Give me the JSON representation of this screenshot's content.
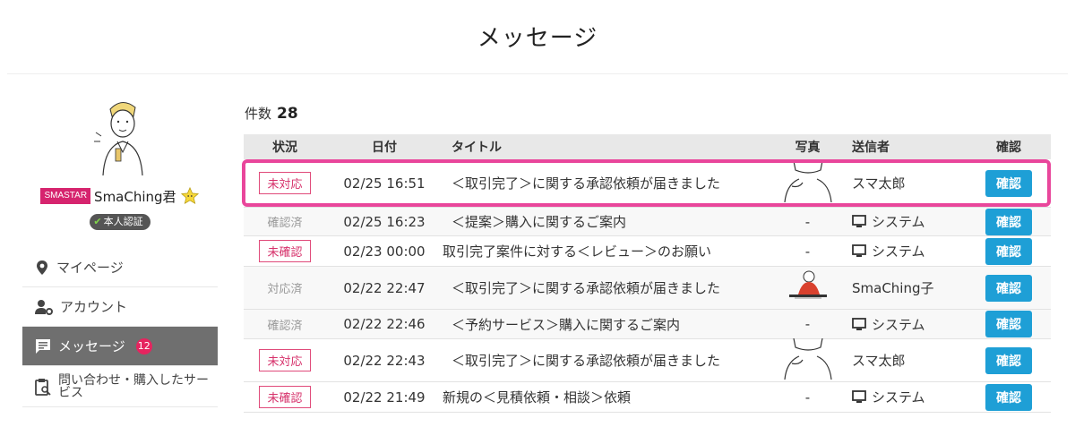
{
  "page": {
    "title": "メッセージ"
  },
  "sidebar": {
    "brand_badge": "SMASTAR",
    "user_name": "SmaChing君",
    "verify_label": "本人認証",
    "nav": [
      {
        "label": "マイページ",
        "icon": "map-pin-icon"
      },
      {
        "label": "アカウント",
        "icon": "user-gear-icon"
      },
      {
        "label": "メッセージ",
        "icon": "message-icon",
        "count": "12",
        "active": true
      },
      {
        "label": "問い合わせ・購入したサービス",
        "icon": "clipboard-search-icon"
      }
    ]
  },
  "summary": {
    "count_label": "件数",
    "count_value": "28"
  },
  "table": {
    "headers": {
      "status": "状況",
      "date": "日付",
      "title": "タイトル",
      "photo": "写真",
      "sender": "送信者",
      "confirm": "確認"
    },
    "rows": [
      {
        "status": "未対応",
        "status_type": "box",
        "date": "02/25 16:51",
        "title": "＜取引完了＞に関する承認依頼が届きました",
        "photo": "person-sketch",
        "sender": "スマ太郎",
        "sender_icon": "",
        "confirm": "確認"
      },
      {
        "status": "確認済",
        "status_type": "done",
        "date": "02/25 16:23",
        "title": "＜提案＞購入に関するご案内",
        "photo": "-",
        "sender": "システム",
        "sender_icon": "monitor-icon",
        "confirm": "確認"
      },
      {
        "status": "未確認",
        "status_type": "box",
        "date": "02/23 00:00",
        "title": "取引完了案件に対する＜レビュー＞のお願い",
        "photo": "-",
        "sender": "システム",
        "sender_icon": "monitor-icon",
        "confirm": "確認"
      },
      {
        "status": "対応済",
        "status_type": "done",
        "date": "02/22 22:47",
        "title": "＜取引完了＞に関する承認依頼が届きました",
        "photo": "cook-sketch",
        "sender": "SmaChing子",
        "sender_icon": "",
        "confirm": "確認"
      },
      {
        "status": "確認済",
        "status_type": "done",
        "date": "02/22 22:46",
        "title": "＜予約サービス＞購入に関するご案内",
        "photo": "-",
        "sender": "システム",
        "sender_icon": "monitor-icon",
        "confirm": "確認"
      },
      {
        "status": "未対応",
        "status_type": "box",
        "date": "02/22 22:43",
        "title": "＜取引完了＞に関する承認依頼が届きました",
        "photo": "person-sketch",
        "sender": "スマ太郎",
        "sender_icon": "",
        "confirm": "確認"
      },
      {
        "status": "未確認",
        "status_type": "box",
        "date": "02/22 21:49",
        "title": "新規の＜見積依頼・相談＞依頼",
        "photo": "-",
        "sender": "システム",
        "sender_icon": "monitor-icon",
        "confirm": "確認"
      }
    ]
  },
  "colors": {
    "accent_pink": "#e9469b",
    "button_blue": "#1e9fd6",
    "badge_red": "#e6245f",
    "brand": "#d6246e"
  }
}
